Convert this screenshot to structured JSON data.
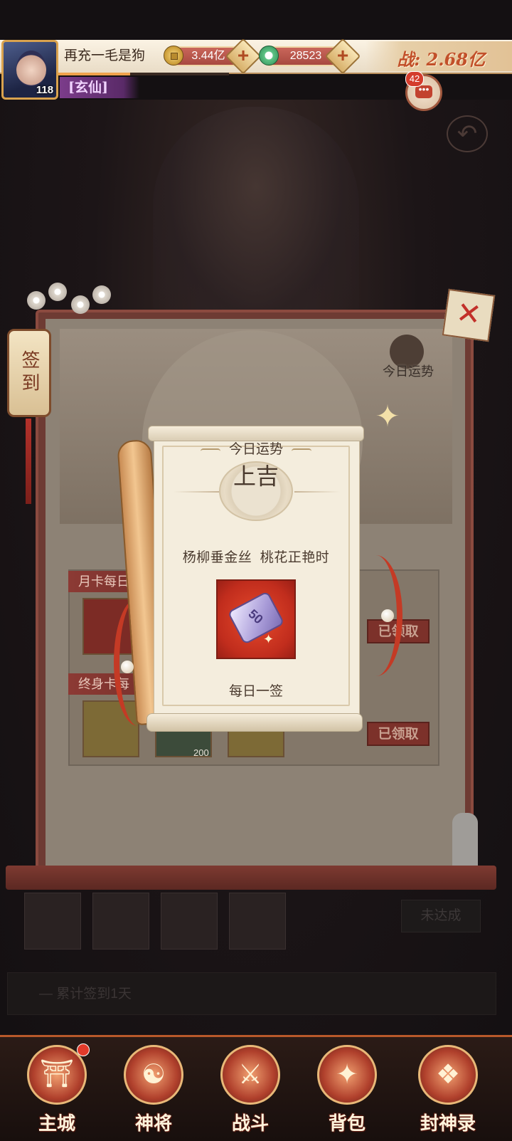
{
  "player": {
    "name": "再充一毛是狗",
    "level": "118",
    "title": "[玄仙]",
    "exp_progress": 0.42
  },
  "resources": {
    "gold": "3.44亿",
    "jade": "28523",
    "power": "战: 2.68亿"
  },
  "chat": {
    "unread": "42"
  },
  "signin": {
    "tab_label": "签到",
    "today_fortune_label": "今日运势",
    "rows": [
      {
        "title": "月卡每日",
        "status": "已领取"
      },
      {
        "title": "终身卡每",
        "status": "已领取"
      }
    ],
    "slot_count": "200",
    "not_reached": "未达成",
    "cumulative": "— 累计签到1天"
  },
  "fortune_popup": {
    "title": "今日运势",
    "result": "上吉",
    "poem": "杨柳垂金丝  桃花正艳时",
    "reward_value": "50",
    "footer": "每日一签"
  },
  "nav": {
    "items": [
      {
        "label": "主城",
        "icon": "city-gate-icon",
        "glyph": "⛩"
      },
      {
        "label": "神将",
        "icon": "hero-icon",
        "glyph": "☯"
      },
      {
        "label": "战斗",
        "icon": "crossed-swords-icon",
        "glyph": "⚔"
      },
      {
        "label": "背包",
        "icon": "bag-icon",
        "glyph": "✦"
      },
      {
        "label": "封神录",
        "icon": "record-icon",
        "glyph": "❖"
      }
    ]
  },
  "colors": {
    "accent_red": "#c2302a",
    "gold": "#d9a24e",
    "scroll_paper": "#f4eddd"
  }
}
